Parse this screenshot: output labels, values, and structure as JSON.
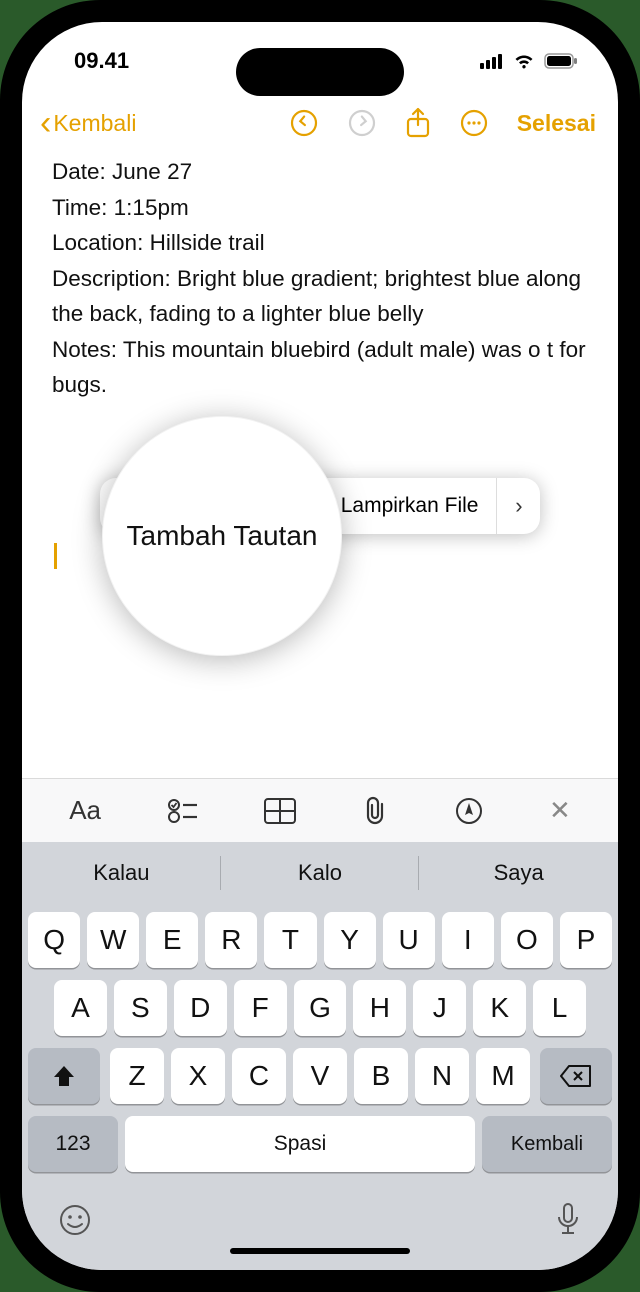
{
  "status": {
    "time": "09.41"
  },
  "nav": {
    "back": "Kembali",
    "done": "Selesai"
  },
  "note": {
    "line1": "Date: June 27",
    "line2": "Time: 1:15pm",
    "line3": "Location: Hillside trail",
    "line4": "Description: Bright blue gradient; brightest blue along the back, fading to a lighter blue belly",
    "line5": "Notes: This mountain bluebird (adult male) was o                     t for bugs."
  },
  "popover": {
    "item1": "Tambah Tautan",
    "item2": "Lampirkan File"
  },
  "magnifier": {
    "text": "Tambah Tautan"
  },
  "suggestions": {
    "s1": "Kalau",
    "s2": "Kalo",
    "s3": "Saya"
  },
  "keys": {
    "r1": [
      "Q",
      "W",
      "E",
      "R",
      "T",
      "Y",
      "U",
      "I",
      "O",
      "P"
    ],
    "r2": [
      "A",
      "S",
      "D",
      "F",
      "G",
      "H",
      "J",
      "K",
      "L"
    ],
    "r3": [
      "Z",
      "X",
      "C",
      "V",
      "B",
      "N",
      "M"
    ],
    "num": "123",
    "space": "Spasi",
    "return": "Kembali"
  }
}
